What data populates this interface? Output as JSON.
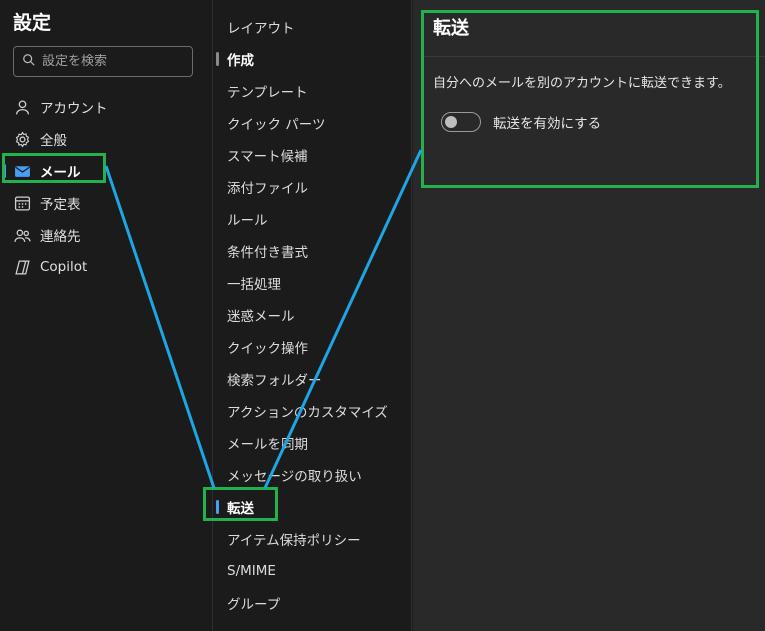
{
  "settings": {
    "title": "設定",
    "search_placeholder": "設定を検索"
  },
  "nav": {
    "items": [
      {
        "label": "アカウント",
        "icon": "person-icon"
      },
      {
        "label": "全般",
        "icon": "gear-icon"
      },
      {
        "label": "メール",
        "icon": "mail-icon"
      },
      {
        "label": "予定表",
        "icon": "calendar-icon"
      },
      {
        "label": "連絡先",
        "icon": "people-icon"
      },
      {
        "label": "Copilot",
        "icon": "copilot-icon"
      }
    ],
    "active": "メール"
  },
  "mail_settings": {
    "items": [
      "レイアウト",
      "作成",
      "テンプレート",
      "クイック パーツ",
      "スマート候補",
      "添付ファイル",
      "ルール",
      "条件付き書式",
      "一括処理",
      "迷惑メール",
      "クイック操作",
      "検索フォルダー",
      "アクションのカスタマイズ",
      "メールを同期",
      "メッセージの取り扱い",
      "転送",
      "アイテム保持ポリシー",
      "S/MIME",
      "グループ"
    ],
    "active": "転送"
  },
  "forwarding": {
    "title": "転送",
    "description": "自分へのメールを別のアカウントに転送できます。",
    "toggle_label": "転送を有効にする",
    "enabled": false
  },
  "colors": {
    "highlight": "#22b14c",
    "callout_line": "#1ea5e3",
    "accent": "#479ef5"
  }
}
